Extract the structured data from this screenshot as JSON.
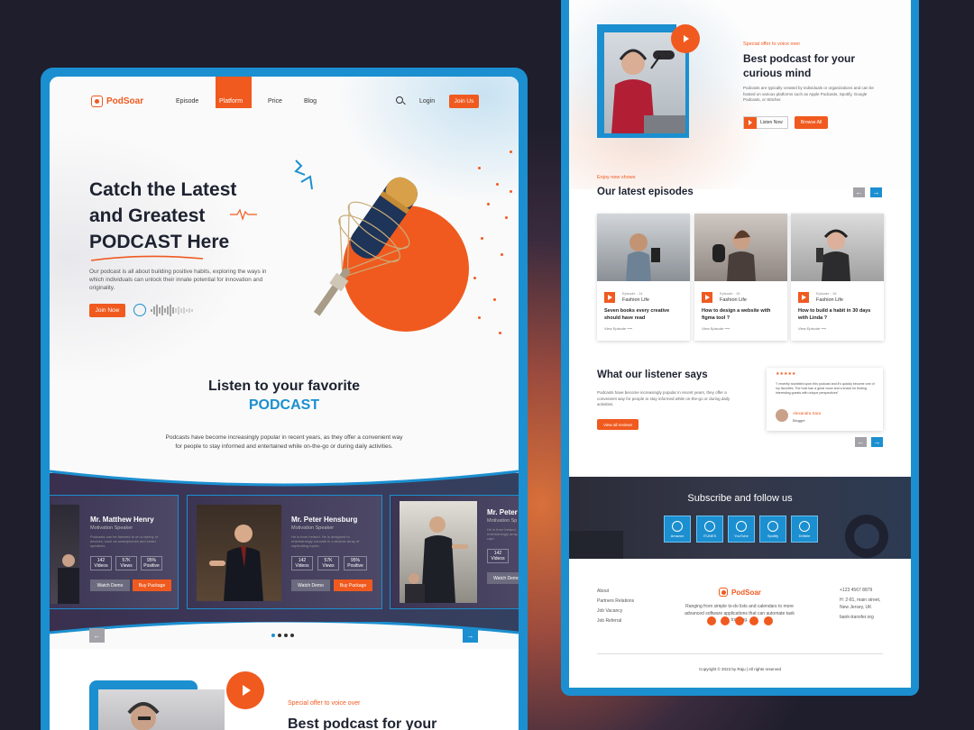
{
  "left": {
    "brand": "PodSoar",
    "nav": [
      "Episode",
      "Platform",
      "Price",
      "Blog"
    ],
    "active_nav": "Platform",
    "login": "Login",
    "join_us": "Join Us",
    "hero": {
      "line1": "Catch the Latest",
      "line2": "and Greatest",
      "line3": "PODCAST Here",
      "desc": "Our podcast is all about building positive habits, exploring the ways in which individuals can unlock their innate potential for innovation and originality.",
      "cta": "Join Now"
    },
    "listen": {
      "title1": "Listen to your favorite",
      "title2": "PODCAST",
      "desc": "Podcasts have become increasingly popular in recent years, as they offer a convenient way for people to stay informed and entertained while on-the-go or during daily activities."
    },
    "speakers": [
      {
        "name": "Mr. Matthew Henry",
        "role": "Motivation Speaker",
        "desc": "Podcasts can be listened to on a variety of devices, such as smartphones and smart speakers.",
        "videos": "142",
        "views": "57K",
        "positive": "95%"
      },
      {
        "name": "Mr. Peter Hensburg",
        "role": "Motivation Speaker",
        "desc": "He is from Ireland. He is designed to entertainingly educate in a diverse array of captivating topics.",
        "videos": "142",
        "views": "57K",
        "positive": "95%"
      },
      {
        "name": "Mr. Peter",
        "role": "Motivation Sp",
        "desc": "He is from Ireland. entertainingly array of capt",
        "videos": "142",
        "views": "",
        "positive": ""
      }
    ],
    "stat_labels": {
      "videos": "Videos",
      "views": "Views",
      "positive": "Positive"
    },
    "watch_demo": "Watch Demo",
    "buy_package": "Buy Package",
    "offer_tag": "Special offer to voice over",
    "offer_title": "Best podcast for your"
  },
  "right": {
    "offer": {
      "tag": "Special offer to voice over",
      "title1": "Best podcast for your",
      "title2": "curious mind",
      "desc": "Podcasts are typically created by individuals or organizations and can be hosted on various platforms such as Apple Podcasts, Spotify, Google Podcasts, or Stitcher.",
      "listen_now": "Listen Now",
      "browse_all": "Browse All"
    },
    "episodes": {
      "tag": "Enjoy new shows",
      "title": "Our latest episodes",
      "items": [
        {
          "episode": "Episode - 14",
          "category": "Fashion Life",
          "title": "Seven books every creative should have read",
          "link": "View Episode"
        },
        {
          "episode": "Episode - 15",
          "category": "Fashion Life",
          "title": "How to design a website with figma tool ?",
          "link": "View Episode"
        },
        {
          "episode": "Episode - 16",
          "category": "Fashion Life",
          "title": "How to build a habit in 30 days with Linda ?",
          "link": "View Episode"
        }
      ]
    },
    "reviews": {
      "title": "What our listener says",
      "desc": "Podcasts have become increasingly popular in recent years, they offer a convenient way for people to stay informed while on-the-go or during daily activities.",
      "cta": "View all reviews",
      "stars": "★★★★★",
      "quote": "\"I recently stumbled upon this podcast and it's quickly become one of my favorites. The host has a great voice and a knack for finding interesting guests with unique perspectives\"",
      "author": "Alexandra Sara",
      "author_role": "Blogger"
    },
    "subscribe": {
      "title": "Subscribe and follow us",
      "platforms": [
        "Amazon",
        "ITUNES",
        "YouTube",
        "Spotify",
        "Dribble"
      ]
    },
    "footer": {
      "links": [
        "About",
        "Partners Relations",
        "Job Vacancy",
        "Job Referral"
      ],
      "brand": "PodSoar",
      "desc": "Ranging from simple to-do lists and calendars to more advanced software applications that can automate task tracking.",
      "phone": "+123 4567 8879",
      "address1": "H: 2-81, main street,",
      "address2": "New Jersey, UK",
      "email": "bank-transfer.org",
      "copyright": "Copyright © 2023 by Raju | All rights reserved"
    }
  }
}
